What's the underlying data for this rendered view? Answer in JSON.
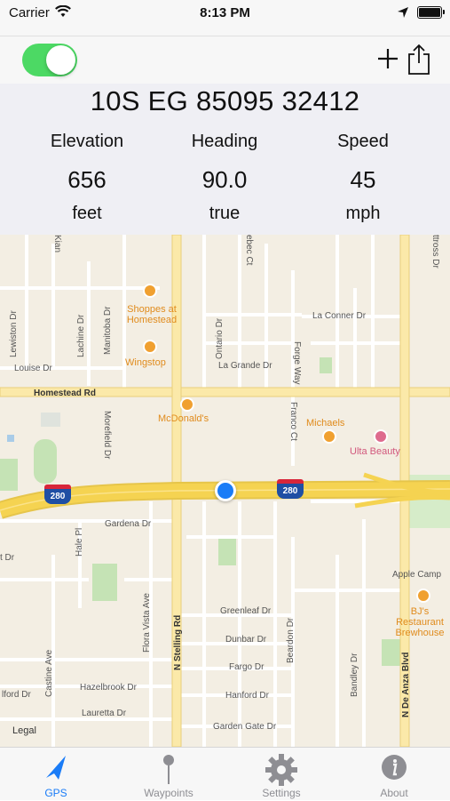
{
  "status_bar": {
    "carrier": "Carrier",
    "time": "8:13 PM"
  },
  "toolbar": {
    "tracking_on": true
  },
  "gps": {
    "coordinates": "10S EG 85095 32412",
    "elevation": {
      "label": "Elevation",
      "value": "656",
      "unit": "feet"
    },
    "heading": {
      "label": "Heading",
      "value": "90.0",
      "unit": "true"
    },
    "speed": {
      "label": "Speed",
      "value": "45",
      "unit": "mph"
    }
  },
  "map": {
    "streets": {
      "homestead": "Homestead Rd",
      "gardena": "Gardena Dr",
      "greenleaf": "Greenleaf Dr",
      "dunbar": "Dunbar Dr",
      "fargo": "Fargo Dr",
      "hanford": "Hanford Dr",
      "hazelbrook": "Hazelbrook Dr",
      "lauretta": "Lauretta Dr",
      "garden_gate": "Garden Gate Dr",
      "la_conner": "La Conner Dr",
      "la_grande": "La Grande Dr",
      "louise": "Louise Dr",
      "lewiston": "Lewiston Dr",
      "lachine": "Lachine Dr",
      "manitoba": "Manitoba Dr",
      "ontario": "Ontario Dr",
      "forge": "Forge Way",
      "franco": "Franco Ct",
      "hale": "Hale Pl",
      "flora_vista": "Flora Vista Ave",
      "stelling": "N Stelling Rd",
      "castine": "Castine Ave",
      "beardon": "Beardon Dr",
      "bandley": "Bandley Dr",
      "de_anza": "N De Anza Blvd",
      "kiana": "Kian",
      "quebec": "ebec Ct",
      "anford": "Hanford Dr",
      "ford": "lford Dr",
      "tross": "ttross Dr",
      "dr_left": "t Dr",
      "dr_left2": "r",
      "morefield": "Morefield Dr"
    },
    "pois": {
      "shoppes": "Shoppes at Homestead",
      "wingstop": "Wingstop",
      "mcdonalds": "McDonald's",
      "michaels": "Michaels",
      "ulta": "Ulta Beauty",
      "apple": "Apple Camp",
      "bjs": "BJ's Restaurant Brewhouse"
    },
    "highway": "280",
    "legal": "Legal"
  },
  "tabs": [
    {
      "label": "GPS",
      "icon": "location-arrow-icon",
      "active": true
    },
    {
      "label": "Waypoints",
      "icon": "pin-icon",
      "active": false
    },
    {
      "label": "Settings",
      "icon": "gear-icon",
      "active": false
    },
    {
      "label": "About",
      "icon": "info-icon",
      "active": false
    }
  ],
  "colors": {
    "accent": "#1a7cf7",
    "switch_on": "#4cd964",
    "highway": "#f5d351"
  }
}
